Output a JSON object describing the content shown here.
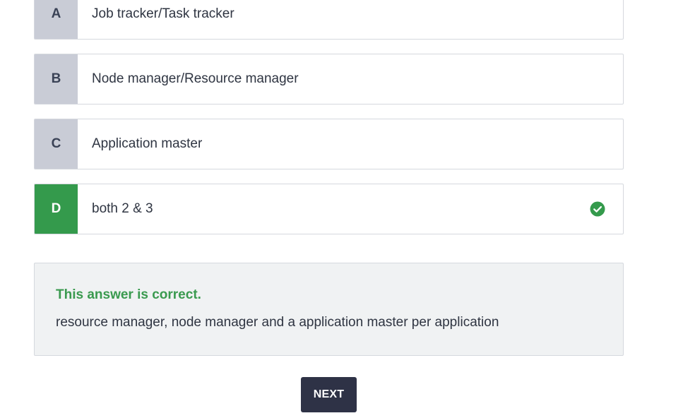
{
  "options": [
    {
      "letter": "A",
      "text": "Job tracker/Task tracker"
    },
    {
      "letter": "B",
      "text": "Node manager/Resource manager"
    },
    {
      "letter": "C",
      "text": "Application master"
    },
    {
      "letter": "D",
      "text": "both 2 & 3",
      "correct": true,
      "icon": "check-circle-icon"
    }
  ],
  "feedback": {
    "status": "This answer is correct.",
    "explanation": "resource manager, node manager and a application master per application"
  },
  "next_button": {
    "label": "NEXT"
  },
  "colors": {
    "correct": "#349a4c",
    "letter_bg": "#c9ccd6",
    "feedback_bg": "#f0f2f3",
    "button_bg": "#2e3246"
  }
}
